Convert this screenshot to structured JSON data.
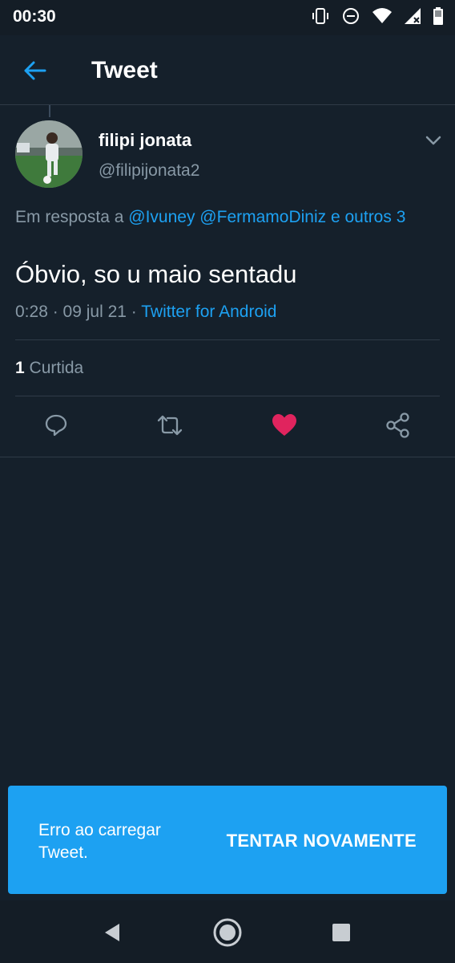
{
  "status_bar": {
    "time": "00:30",
    "icons": [
      "vibrate-icon",
      "do-not-disturb-icon",
      "wifi-icon",
      "signal-icon",
      "battery-icon"
    ]
  },
  "app_bar": {
    "title": "Tweet",
    "back_icon": "arrow-left-icon"
  },
  "tweet": {
    "author_name": "filipi jonata",
    "author_handle": "@filipijonata2",
    "reply_prefix": "Em resposta a",
    "mentions": [
      "@Ivuney",
      "@FermamoDiniz"
    ],
    "reply_suffix": "e outros 3",
    "text": "Óbvio, so u maio sentadu",
    "timestamp": "0:28 · 09 jul 21 ·",
    "source": "Twitter for Android",
    "likes_count": "1",
    "likes_label": "Curtida",
    "liked": true
  },
  "actions": [
    "reply-icon",
    "retweet-icon",
    "like-icon",
    "share-icon"
  ],
  "snackbar": {
    "message": "Erro ao carregar Tweet.",
    "action_label": "TENTAR NOVAMENTE"
  },
  "colors": {
    "background": "#15202b",
    "accent": "#1da1f2",
    "like": "#e0245e",
    "muted_text": "#8899a6",
    "divider": "#2f3b47"
  },
  "nav_bar": [
    "back-triangle-icon",
    "home-circle-icon",
    "recents-square-icon"
  ]
}
